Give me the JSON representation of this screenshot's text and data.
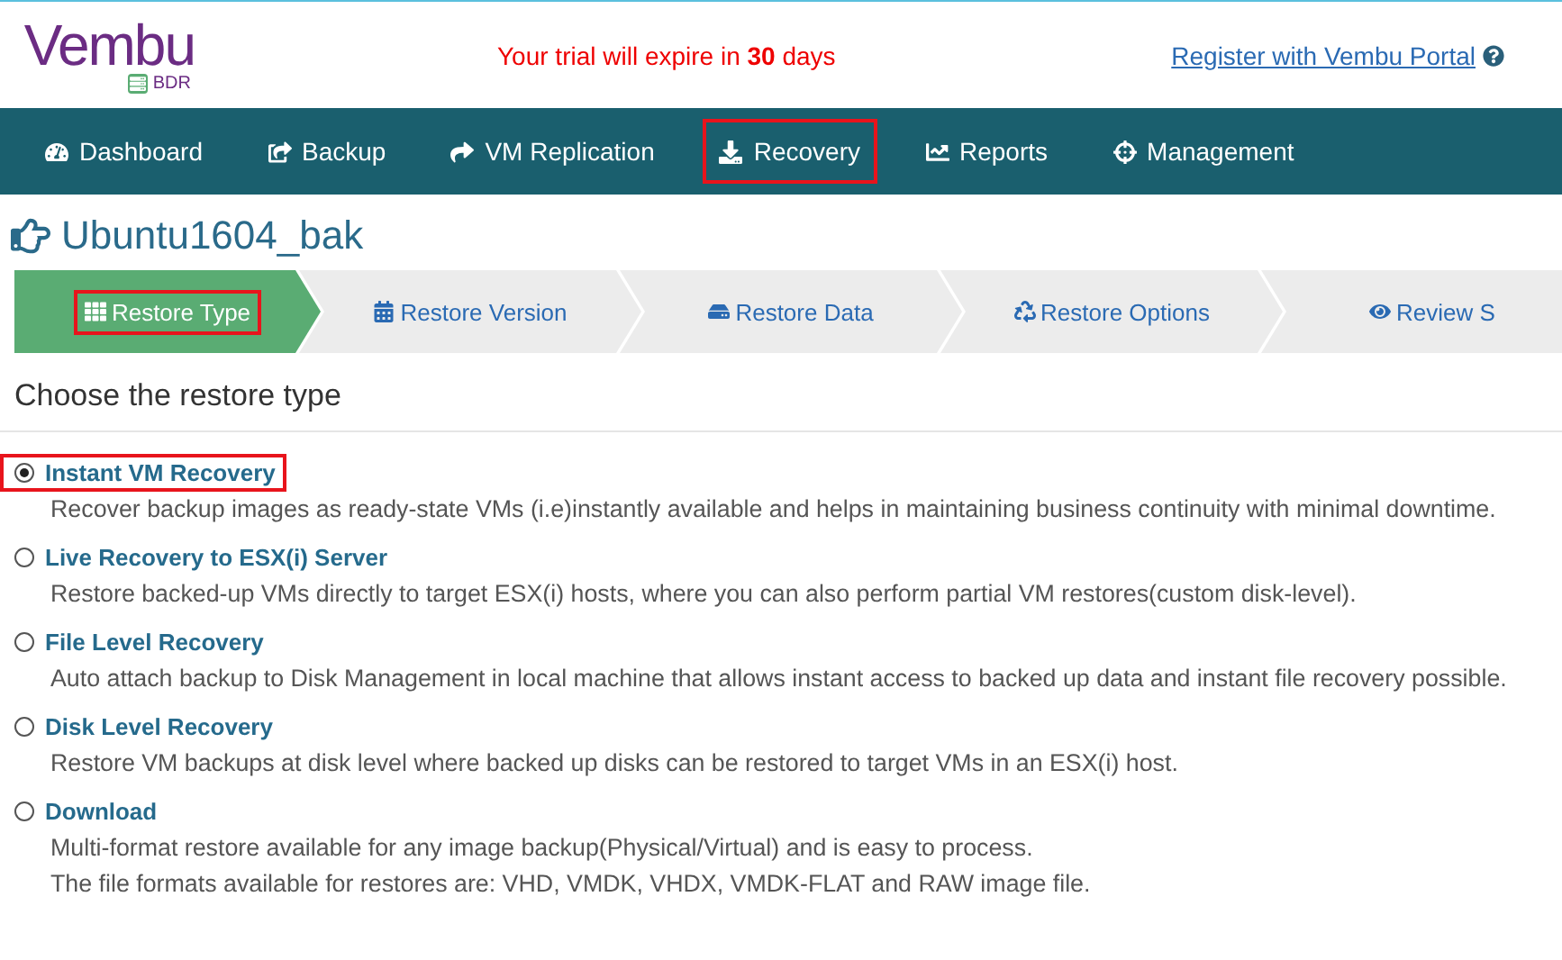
{
  "logo": {
    "name": "Vembu",
    "badge": "BDR"
  },
  "trial": {
    "before": "Your trial will expire in ",
    "days": "30",
    "after": " days"
  },
  "register_link": "Register with Vembu Portal",
  "nav": [
    {
      "label": "Dashboard",
      "highlighted": false
    },
    {
      "label": "Backup",
      "highlighted": false
    },
    {
      "label": "VM Replication",
      "highlighted": false
    },
    {
      "label": "Recovery",
      "highlighted": true
    },
    {
      "label": "Reports",
      "highlighted": false
    },
    {
      "label": "Management",
      "highlighted": false
    }
  ],
  "page_title": "Ubuntu1604_bak",
  "steps": [
    {
      "label": "Restore Type",
      "selected": true,
      "highlighted": true
    },
    {
      "label": "Restore Version",
      "selected": false,
      "highlighted": false
    },
    {
      "label": "Restore Data",
      "selected": false,
      "highlighted": false
    },
    {
      "label": "Restore Options",
      "selected": false,
      "highlighted": false
    },
    {
      "label": "Review S",
      "selected": false,
      "highlighted": false
    }
  ],
  "heading": "Choose the restore type",
  "options": [
    {
      "title": "Instant VM Recovery",
      "selected": true,
      "highlighted": true,
      "lines": [
        "Recover backup images as ready-state VMs (i.e)instantly available and helps in maintaining business continuity with minimal downtime."
      ]
    },
    {
      "title": "Live Recovery to ESX(i) Server",
      "selected": false,
      "highlighted": false,
      "lines": [
        "Restore backed-up VMs directly to target ESX(i) hosts, where you can also perform partial VM restores(custom disk-level)."
      ]
    },
    {
      "title": "File Level Recovery",
      "selected": false,
      "highlighted": false,
      "lines": [
        "Auto attach backup to Disk Management in local machine that allows instant access to backed up data and instant file recovery possible."
      ]
    },
    {
      "title": "Disk Level Recovery",
      "selected": false,
      "highlighted": false,
      "lines": [
        "Restore VM backups at disk level where backed up disks can be restored to target VMs in an ESX(i) host."
      ]
    },
    {
      "title": "Download",
      "selected": false,
      "highlighted": false,
      "lines": [
        "Multi-format restore available for any image backup(Physical/Virtual) and is easy to process.",
        "The file formats available for restores are: VHD, VMDK, VHDX, VMDK-FLAT and RAW image file."
      ]
    }
  ]
}
